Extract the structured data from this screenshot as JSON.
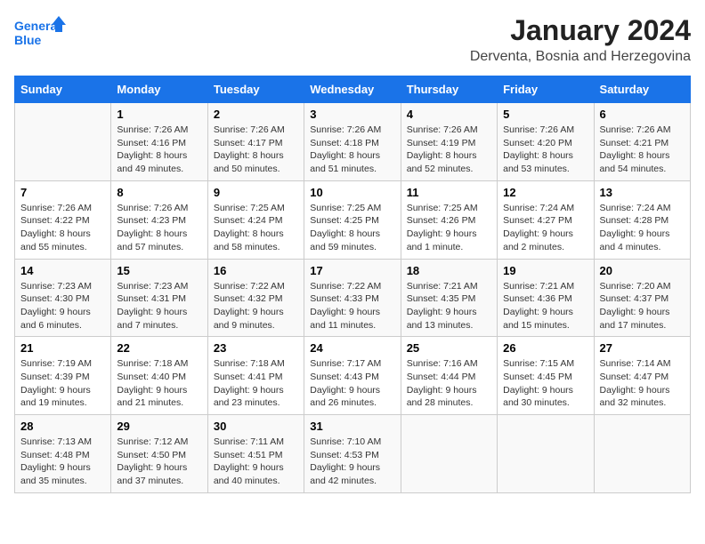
{
  "header": {
    "logo_line1": "General",
    "logo_line2": "Blue",
    "month": "January 2024",
    "location": "Derventa, Bosnia and Herzegovina"
  },
  "days_of_week": [
    "Sunday",
    "Monday",
    "Tuesday",
    "Wednesday",
    "Thursday",
    "Friday",
    "Saturday"
  ],
  "weeks": [
    [
      {
        "day": "",
        "sunrise": "",
        "sunset": "",
        "daylight": ""
      },
      {
        "day": "1",
        "sunrise": "Sunrise: 7:26 AM",
        "sunset": "Sunset: 4:16 PM",
        "daylight": "Daylight: 8 hours and 49 minutes."
      },
      {
        "day": "2",
        "sunrise": "Sunrise: 7:26 AM",
        "sunset": "Sunset: 4:17 PM",
        "daylight": "Daylight: 8 hours and 50 minutes."
      },
      {
        "day": "3",
        "sunrise": "Sunrise: 7:26 AM",
        "sunset": "Sunset: 4:18 PM",
        "daylight": "Daylight: 8 hours and 51 minutes."
      },
      {
        "day": "4",
        "sunrise": "Sunrise: 7:26 AM",
        "sunset": "Sunset: 4:19 PM",
        "daylight": "Daylight: 8 hours and 52 minutes."
      },
      {
        "day": "5",
        "sunrise": "Sunrise: 7:26 AM",
        "sunset": "Sunset: 4:20 PM",
        "daylight": "Daylight: 8 hours and 53 minutes."
      },
      {
        "day": "6",
        "sunrise": "Sunrise: 7:26 AM",
        "sunset": "Sunset: 4:21 PM",
        "daylight": "Daylight: 8 hours and 54 minutes."
      }
    ],
    [
      {
        "day": "7",
        "sunrise": "Sunrise: 7:26 AM",
        "sunset": "Sunset: 4:22 PM",
        "daylight": "Daylight: 8 hours and 55 minutes."
      },
      {
        "day": "8",
        "sunrise": "Sunrise: 7:26 AM",
        "sunset": "Sunset: 4:23 PM",
        "daylight": "Daylight: 8 hours and 57 minutes."
      },
      {
        "day": "9",
        "sunrise": "Sunrise: 7:25 AM",
        "sunset": "Sunset: 4:24 PM",
        "daylight": "Daylight: 8 hours and 58 minutes."
      },
      {
        "day": "10",
        "sunrise": "Sunrise: 7:25 AM",
        "sunset": "Sunset: 4:25 PM",
        "daylight": "Daylight: 8 hours and 59 minutes."
      },
      {
        "day": "11",
        "sunrise": "Sunrise: 7:25 AM",
        "sunset": "Sunset: 4:26 PM",
        "daylight": "Daylight: 9 hours and 1 minute."
      },
      {
        "day": "12",
        "sunrise": "Sunrise: 7:24 AM",
        "sunset": "Sunset: 4:27 PM",
        "daylight": "Daylight: 9 hours and 2 minutes."
      },
      {
        "day": "13",
        "sunrise": "Sunrise: 7:24 AM",
        "sunset": "Sunset: 4:28 PM",
        "daylight": "Daylight: 9 hours and 4 minutes."
      }
    ],
    [
      {
        "day": "14",
        "sunrise": "Sunrise: 7:23 AM",
        "sunset": "Sunset: 4:30 PM",
        "daylight": "Daylight: 9 hours and 6 minutes."
      },
      {
        "day": "15",
        "sunrise": "Sunrise: 7:23 AM",
        "sunset": "Sunset: 4:31 PM",
        "daylight": "Daylight: 9 hours and 7 minutes."
      },
      {
        "day": "16",
        "sunrise": "Sunrise: 7:22 AM",
        "sunset": "Sunset: 4:32 PM",
        "daylight": "Daylight: 9 hours and 9 minutes."
      },
      {
        "day": "17",
        "sunrise": "Sunrise: 7:22 AM",
        "sunset": "Sunset: 4:33 PM",
        "daylight": "Daylight: 9 hours and 11 minutes."
      },
      {
        "day": "18",
        "sunrise": "Sunrise: 7:21 AM",
        "sunset": "Sunset: 4:35 PM",
        "daylight": "Daylight: 9 hours and 13 minutes."
      },
      {
        "day": "19",
        "sunrise": "Sunrise: 7:21 AM",
        "sunset": "Sunset: 4:36 PM",
        "daylight": "Daylight: 9 hours and 15 minutes."
      },
      {
        "day": "20",
        "sunrise": "Sunrise: 7:20 AM",
        "sunset": "Sunset: 4:37 PM",
        "daylight": "Daylight: 9 hours and 17 minutes."
      }
    ],
    [
      {
        "day": "21",
        "sunrise": "Sunrise: 7:19 AM",
        "sunset": "Sunset: 4:39 PM",
        "daylight": "Daylight: 9 hours and 19 minutes."
      },
      {
        "day": "22",
        "sunrise": "Sunrise: 7:18 AM",
        "sunset": "Sunset: 4:40 PM",
        "daylight": "Daylight: 9 hours and 21 minutes."
      },
      {
        "day": "23",
        "sunrise": "Sunrise: 7:18 AM",
        "sunset": "Sunset: 4:41 PM",
        "daylight": "Daylight: 9 hours and 23 minutes."
      },
      {
        "day": "24",
        "sunrise": "Sunrise: 7:17 AM",
        "sunset": "Sunset: 4:43 PM",
        "daylight": "Daylight: 9 hours and 26 minutes."
      },
      {
        "day": "25",
        "sunrise": "Sunrise: 7:16 AM",
        "sunset": "Sunset: 4:44 PM",
        "daylight": "Daylight: 9 hours and 28 minutes."
      },
      {
        "day": "26",
        "sunrise": "Sunrise: 7:15 AM",
        "sunset": "Sunset: 4:45 PM",
        "daylight": "Daylight: 9 hours and 30 minutes."
      },
      {
        "day": "27",
        "sunrise": "Sunrise: 7:14 AM",
        "sunset": "Sunset: 4:47 PM",
        "daylight": "Daylight: 9 hours and 32 minutes."
      }
    ],
    [
      {
        "day": "28",
        "sunrise": "Sunrise: 7:13 AM",
        "sunset": "Sunset: 4:48 PM",
        "daylight": "Daylight: 9 hours and 35 minutes."
      },
      {
        "day": "29",
        "sunrise": "Sunrise: 7:12 AM",
        "sunset": "Sunset: 4:50 PM",
        "daylight": "Daylight: 9 hours and 37 minutes."
      },
      {
        "day": "30",
        "sunrise": "Sunrise: 7:11 AM",
        "sunset": "Sunset: 4:51 PM",
        "daylight": "Daylight: 9 hours and 40 minutes."
      },
      {
        "day": "31",
        "sunrise": "Sunrise: 7:10 AM",
        "sunset": "Sunset: 4:53 PM",
        "daylight": "Daylight: 9 hours and 42 minutes."
      },
      {
        "day": "",
        "sunrise": "",
        "sunset": "",
        "daylight": ""
      },
      {
        "day": "",
        "sunrise": "",
        "sunset": "",
        "daylight": ""
      },
      {
        "day": "",
        "sunrise": "",
        "sunset": "",
        "daylight": ""
      }
    ]
  ]
}
